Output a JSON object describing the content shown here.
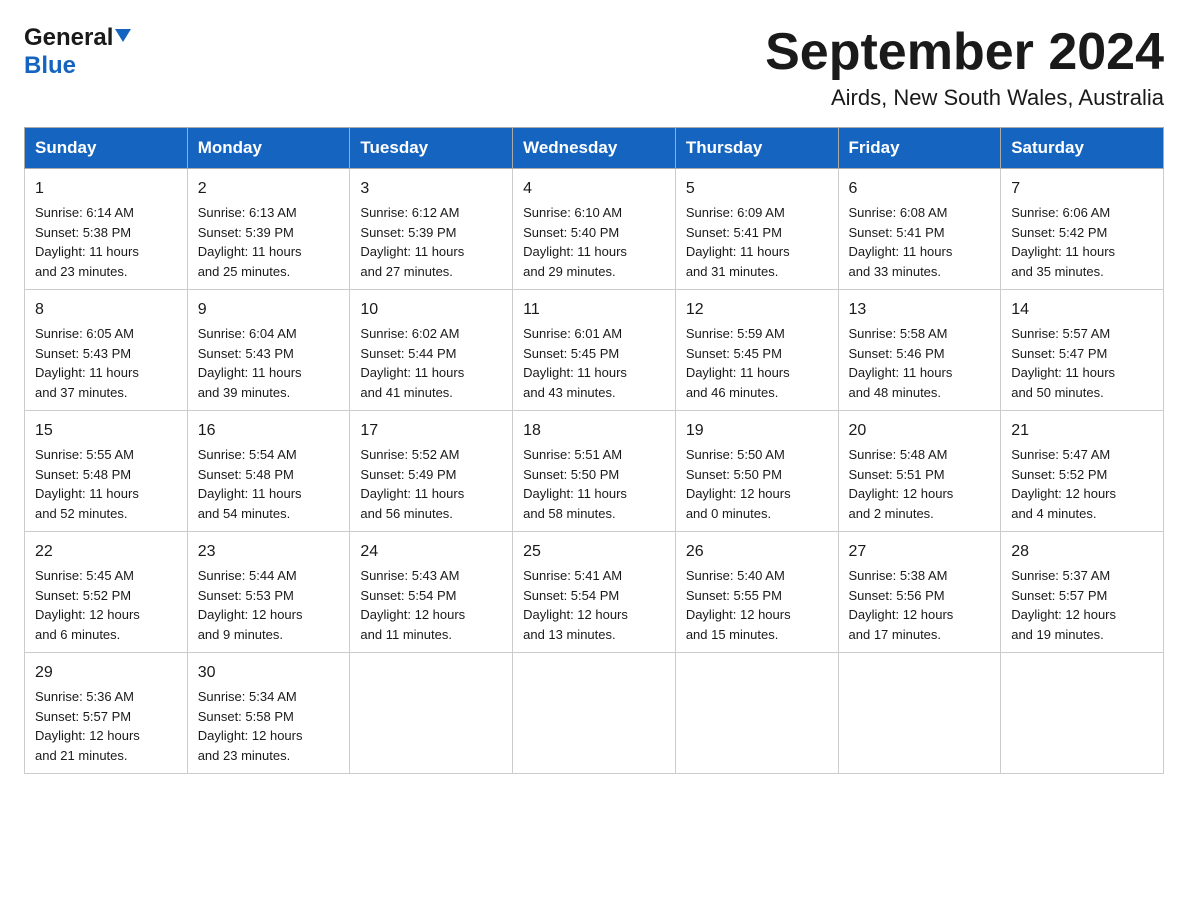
{
  "header": {
    "logo_general": "General",
    "logo_blue": "Blue",
    "month_title": "September 2024",
    "location": "Airds, New South Wales, Australia"
  },
  "days_of_week": [
    "Sunday",
    "Monday",
    "Tuesday",
    "Wednesday",
    "Thursday",
    "Friday",
    "Saturday"
  ],
  "weeks": [
    [
      {
        "day": "1",
        "sunrise": "6:14 AM",
        "sunset": "5:38 PM",
        "daylight": "11 hours and 23 minutes."
      },
      {
        "day": "2",
        "sunrise": "6:13 AM",
        "sunset": "5:39 PM",
        "daylight": "11 hours and 25 minutes."
      },
      {
        "day": "3",
        "sunrise": "6:12 AM",
        "sunset": "5:39 PM",
        "daylight": "11 hours and 27 minutes."
      },
      {
        "day": "4",
        "sunrise": "6:10 AM",
        "sunset": "5:40 PM",
        "daylight": "11 hours and 29 minutes."
      },
      {
        "day": "5",
        "sunrise": "6:09 AM",
        "sunset": "5:41 PM",
        "daylight": "11 hours and 31 minutes."
      },
      {
        "day": "6",
        "sunrise": "6:08 AM",
        "sunset": "5:41 PM",
        "daylight": "11 hours and 33 minutes."
      },
      {
        "day": "7",
        "sunrise": "6:06 AM",
        "sunset": "5:42 PM",
        "daylight": "11 hours and 35 minutes."
      }
    ],
    [
      {
        "day": "8",
        "sunrise": "6:05 AM",
        "sunset": "5:43 PM",
        "daylight": "11 hours and 37 minutes."
      },
      {
        "day": "9",
        "sunrise": "6:04 AM",
        "sunset": "5:43 PM",
        "daylight": "11 hours and 39 minutes."
      },
      {
        "day": "10",
        "sunrise": "6:02 AM",
        "sunset": "5:44 PM",
        "daylight": "11 hours and 41 minutes."
      },
      {
        "day": "11",
        "sunrise": "6:01 AM",
        "sunset": "5:45 PM",
        "daylight": "11 hours and 43 minutes."
      },
      {
        "day": "12",
        "sunrise": "5:59 AM",
        "sunset": "5:45 PM",
        "daylight": "11 hours and 46 minutes."
      },
      {
        "day": "13",
        "sunrise": "5:58 AM",
        "sunset": "5:46 PM",
        "daylight": "11 hours and 48 minutes."
      },
      {
        "day": "14",
        "sunrise": "5:57 AM",
        "sunset": "5:47 PM",
        "daylight": "11 hours and 50 minutes."
      }
    ],
    [
      {
        "day": "15",
        "sunrise": "5:55 AM",
        "sunset": "5:48 PM",
        "daylight": "11 hours and 52 minutes."
      },
      {
        "day": "16",
        "sunrise": "5:54 AM",
        "sunset": "5:48 PM",
        "daylight": "11 hours and 54 minutes."
      },
      {
        "day": "17",
        "sunrise": "5:52 AM",
        "sunset": "5:49 PM",
        "daylight": "11 hours and 56 minutes."
      },
      {
        "day": "18",
        "sunrise": "5:51 AM",
        "sunset": "5:50 PM",
        "daylight": "11 hours and 58 minutes."
      },
      {
        "day": "19",
        "sunrise": "5:50 AM",
        "sunset": "5:50 PM",
        "daylight": "12 hours and 0 minutes."
      },
      {
        "day": "20",
        "sunrise": "5:48 AM",
        "sunset": "5:51 PM",
        "daylight": "12 hours and 2 minutes."
      },
      {
        "day": "21",
        "sunrise": "5:47 AM",
        "sunset": "5:52 PM",
        "daylight": "12 hours and 4 minutes."
      }
    ],
    [
      {
        "day": "22",
        "sunrise": "5:45 AM",
        "sunset": "5:52 PM",
        "daylight": "12 hours and 6 minutes."
      },
      {
        "day": "23",
        "sunrise": "5:44 AM",
        "sunset": "5:53 PM",
        "daylight": "12 hours and 9 minutes."
      },
      {
        "day": "24",
        "sunrise": "5:43 AM",
        "sunset": "5:54 PM",
        "daylight": "12 hours and 11 minutes."
      },
      {
        "day": "25",
        "sunrise": "5:41 AM",
        "sunset": "5:54 PM",
        "daylight": "12 hours and 13 minutes."
      },
      {
        "day": "26",
        "sunrise": "5:40 AM",
        "sunset": "5:55 PM",
        "daylight": "12 hours and 15 minutes."
      },
      {
        "day": "27",
        "sunrise": "5:38 AM",
        "sunset": "5:56 PM",
        "daylight": "12 hours and 17 minutes."
      },
      {
        "day": "28",
        "sunrise": "5:37 AM",
        "sunset": "5:57 PM",
        "daylight": "12 hours and 19 minutes."
      }
    ],
    [
      {
        "day": "29",
        "sunrise": "5:36 AM",
        "sunset": "5:57 PM",
        "daylight": "12 hours and 21 minutes."
      },
      {
        "day": "30",
        "sunrise": "5:34 AM",
        "sunset": "5:58 PM",
        "daylight": "12 hours and 23 minutes."
      },
      null,
      null,
      null,
      null,
      null
    ]
  ],
  "labels": {
    "sunrise": "Sunrise:",
    "sunset": "Sunset:",
    "daylight": "Daylight:"
  }
}
